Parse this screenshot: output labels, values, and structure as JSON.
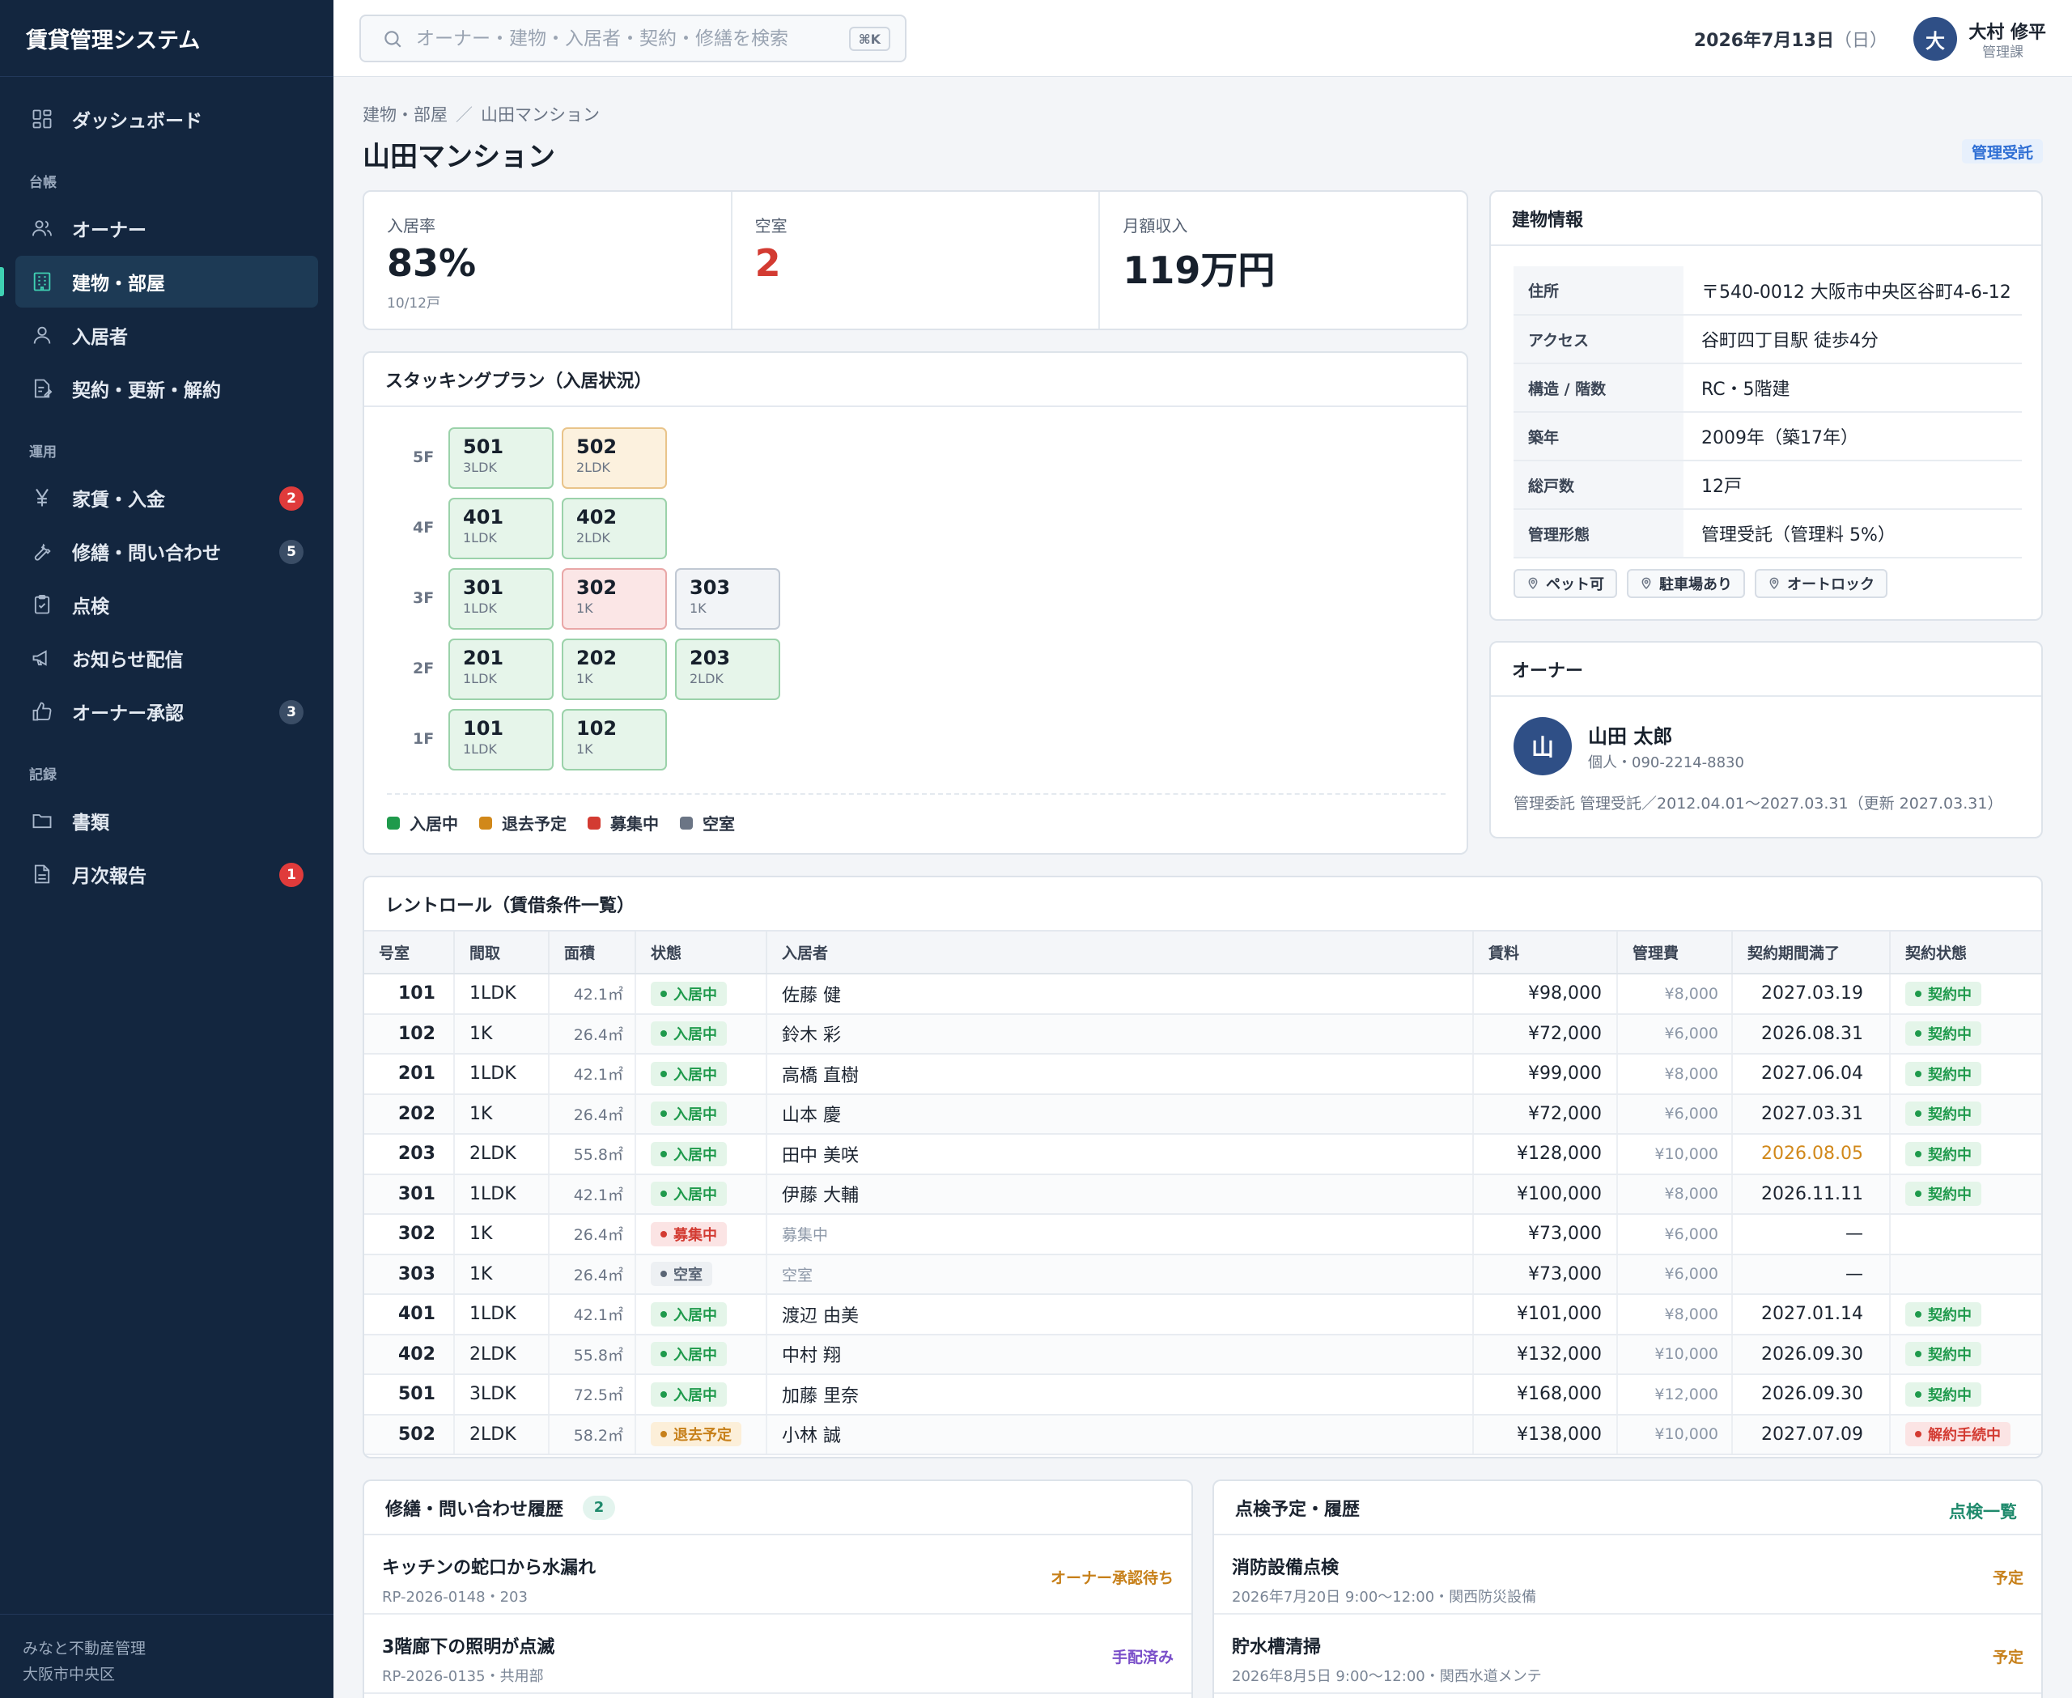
{
  "app_title": "賃貸管理システム",
  "sidebar": {
    "items": [
      {
        "label": "ダッシュボード",
        "icon": "dashboard-icon"
      },
      {
        "section": "台帳"
      },
      {
        "label": "オーナー",
        "icon": "owners-icon"
      },
      {
        "label": "建物・部屋",
        "icon": "building-icon",
        "active": true
      },
      {
        "label": "入居者",
        "icon": "tenant-icon"
      },
      {
        "label": "契約・更新・解約",
        "icon": "contract-icon"
      },
      {
        "section": "運用"
      },
      {
        "label": "家賃・入金",
        "icon": "yen-icon",
        "badge": "2"
      },
      {
        "label": "修繕・問い合わせ",
        "icon": "wrench-icon",
        "badge": "5"
      },
      {
        "label": "点検",
        "icon": "clipboard-icon"
      },
      {
        "label": "お知らせ配信",
        "icon": "megaphone-icon"
      },
      {
        "label": "オーナー承認",
        "icon": "thumbs-up-icon",
        "badge": "3"
      },
      {
        "section": "記録"
      },
      {
        "label": "書類",
        "icon": "folder-icon"
      },
      {
        "label": "月次報告",
        "icon": "report-icon",
        "badge": "1"
      }
    ],
    "labels": {
      "dashboard": "ダッシュボード",
      "sec_ledger": "台帳",
      "owners": "オーナー",
      "buildings": "建物・部屋",
      "tenants": "入居者",
      "contracts": "契約・更新・解約",
      "sec_ops": "運用",
      "rent": "家賃・入金",
      "repairs": "修繕・問い合わせ",
      "inspection": "点検",
      "notice": "お知らせ配信",
      "approval": "オーナー承認",
      "sec_records": "記録",
      "docs": "書類",
      "monthly": "月次報告"
    },
    "badges": {
      "rent": "2",
      "repairs": "5",
      "approval": "3",
      "monthly": "1"
    },
    "footer_company": "みなと不動産管理",
    "footer_area": "大阪市中央区"
  },
  "topbar": {
    "search_placeholder": "オーナー・建物・入居者・契約・修繕を検索",
    "search_shortcut": "⌘K",
    "date": "2026年7月13日",
    "weekday": "（日）",
    "user_initial": "大",
    "user_name": "大村 修平",
    "user_role": "管理課"
  },
  "page": {
    "breadcrumb_parent": "建物・部屋",
    "breadcrumb_sep": "／",
    "breadcrumb_current": "山田マンション",
    "title": "山田マンション",
    "management_tag": "管理受託"
  },
  "stats": {
    "occupancy_label": "入居率",
    "occupancy_value": "83%",
    "occupancy_sub": "10/12戸",
    "vacancy_label": "空室",
    "vacancy_value": "2",
    "income_label": "月額収入",
    "income_value": "119万円"
  },
  "stacking": {
    "title": "スタッキングプラン（入居状況）",
    "floors": [
      "5F",
      "4F",
      "3F",
      "2F",
      "1F"
    ],
    "units": [
      {
        "num": "501",
        "layout": "3LDK",
        "status": "occ"
      },
      {
        "num": "502",
        "layout": "2LDK",
        "status": "leave"
      },
      {
        "num": "401",
        "layout": "1LDK",
        "status": "occ"
      },
      {
        "num": "402",
        "layout": "2LDK",
        "status": "occ"
      },
      {
        "num": "301",
        "layout": "1LDK",
        "status": "occ"
      },
      {
        "num": "302",
        "layout": "1K",
        "status": "recruit"
      },
      {
        "num": "303",
        "layout": "1K",
        "status": "vacant"
      },
      {
        "num": "201",
        "layout": "1LDK",
        "status": "occ"
      },
      {
        "num": "202",
        "layout": "1K",
        "status": "occ"
      },
      {
        "num": "203",
        "layout": "2LDK",
        "status": "occ"
      },
      {
        "num": "101",
        "layout": "1LDK",
        "status": "occ"
      },
      {
        "num": "102",
        "layout": "1K",
        "status": "occ"
      }
    ],
    "legend": [
      {
        "label": "入居中",
        "color": "#1f9a4c"
      },
      {
        "label": "退去予定",
        "color": "#d1881a"
      },
      {
        "label": "募集中",
        "color": "#d33b32"
      },
      {
        "label": "空室",
        "color": "#6b7585"
      }
    ]
  },
  "building_info": {
    "title": "建物情報",
    "rows": [
      {
        "k": "住所",
        "v": "〒540-0012 大阪市中央区谷町4-6-12"
      },
      {
        "k": "アクセス",
        "v": "谷町四丁目駅 徒歩4分"
      },
      {
        "k": "構造 / 階数",
        "v": "RC・5階建"
      },
      {
        "k": "築年",
        "v": "2009年（築17年）"
      },
      {
        "k": "総戸数",
        "v": "12戸"
      },
      {
        "k": "管理形態",
        "v": "管理受託（管理料 5%）"
      }
    ],
    "chips": [
      "ペット可",
      "駐車場あり",
      "オートロック"
    ]
  },
  "owner": {
    "title": "オーナー",
    "initial": "山",
    "name": "山田 太郎",
    "sub": "個人・090-2214-8830",
    "contract": "管理委託 管理受託／2012.04.01〜2027.03.31（更新 2027.03.31）"
  },
  "rent_roll": {
    "title": "レントロール（賃借条件一覧）",
    "columns": [
      "号室",
      "間取",
      "面積",
      "状態",
      "入居者",
      "賃料",
      "管理費",
      "契約期間満了",
      "契約状態"
    ],
    "rows": [
      {
        "room": "101",
        "layout": "1LDK",
        "area": "42.1㎡",
        "status": "入居中",
        "sc": "green",
        "tenant": "佐藤 健",
        "rent": "¥98,000",
        "fee": "¥8,000",
        "end": "2027.03.19",
        "contract": "契約中",
        "cc": "green"
      },
      {
        "room": "102",
        "layout": "1K",
        "area": "26.4㎡",
        "status": "入居中",
        "sc": "green",
        "tenant": "鈴木 彩",
        "rent": "¥72,000",
        "fee": "¥6,000",
        "end": "2026.08.31",
        "contract": "契約中",
        "cc": "green"
      },
      {
        "room": "201",
        "layout": "1LDK",
        "area": "42.1㎡",
        "status": "入居中",
        "sc": "green",
        "tenant": "高橋 直樹",
        "rent": "¥99,000",
        "fee": "¥8,000",
        "end": "2027.06.04",
        "contract": "契約中",
        "cc": "green"
      },
      {
        "room": "202",
        "layout": "1K",
        "area": "26.4㎡",
        "status": "入居中",
        "sc": "green",
        "tenant": "山本 慶",
        "rent": "¥72,000",
        "fee": "¥6,000",
        "end": "2027.03.31",
        "contract": "契約中",
        "cc": "green"
      },
      {
        "room": "203",
        "layout": "2LDK",
        "area": "55.8㎡",
        "status": "入居中",
        "sc": "green",
        "tenant": "田中 美咲",
        "rent": "¥128,000",
        "fee": "¥10,000",
        "end": "2026.08.05",
        "end_warn": true,
        "contract": "契約中",
        "cc": "green"
      },
      {
        "room": "301",
        "layout": "1LDK",
        "area": "42.1㎡",
        "status": "入居中",
        "sc": "green",
        "tenant": "伊藤 大輔",
        "rent": "¥100,000",
        "fee": "¥8,000",
        "end": "2026.11.11",
        "contract": "契約中",
        "cc": "green"
      },
      {
        "room": "302",
        "layout": "1K",
        "area": "26.4㎡",
        "status": "募集中",
        "sc": "red",
        "tenant": "募集中",
        "tenant_muted": true,
        "rent": "¥73,000",
        "fee": "¥6,000",
        "end": "—",
        "contract": "",
        "cc": ""
      },
      {
        "room": "303",
        "layout": "1K",
        "area": "26.4㎡",
        "status": "空室",
        "sc": "gray",
        "tenant": "空室",
        "tenant_muted": true,
        "rent": "¥73,000",
        "fee": "¥6,000",
        "end": "—",
        "contract": "",
        "cc": ""
      },
      {
        "room": "401",
        "layout": "1LDK",
        "area": "42.1㎡",
        "status": "入居中",
        "sc": "green",
        "tenant": "渡辺 由美",
        "rent": "¥101,000",
        "fee": "¥8,000",
        "end": "2027.01.14",
        "contract": "契約中",
        "cc": "green"
      },
      {
        "room": "402",
        "layout": "2LDK",
        "area": "55.8㎡",
        "status": "入居中",
        "sc": "green",
        "tenant": "中村 翔",
        "rent": "¥132,000",
        "fee": "¥10,000",
        "end": "2026.09.30",
        "contract": "契約中",
        "cc": "green"
      },
      {
        "room": "501",
        "layout": "3LDK",
        "area": "72.5㎡",
        "status": "入居中",
        "sc": "green",
        "tenant": "加藤 里奈",
        "rent": "¥168,000",
        "fee": "¥12,000",
        "end": "2026.09.30",
        "contract": "契約中",
        "cc": "green"
      },
      {
        "room": "502",
        "layout": "2LDK",
        "area": "58.2㎡",
        "status": "退去予定",
        "sc": "amber",
        "tenant": "小林 誠",
        "rent": "¥138,000",
        "fee": "¥10,000",
        "end": "2027.07.09",
        "contract": "解約手続中",
        "cc": "red"
      }
    ]
  },
  "repairs": {
    "title": "修繕・問い合わせ履歴",
    "count": "2",
    "items": [
      {
        "title": "キッチンの蛇口から水漏れ",
        "sub": "RP-2026-0148・203",
        "status": "オーナー承認待ち",
        "tone": "amber"
      },
      {
        "title": "3階廊下の照明が点滅",
        "sub": "RP-2026-0135・共用部",
        "status": "手配済み",
        "tone": "purple"
      }
    ]
  },
  "inspections": {
    "title": "点検予定・履歴",
    "link": "点検一覧",
    "items": [
      {
        "title": "消防設備点検",
        "sub": "2026年7月20日 9:00〜12:00・関西防災設備",
        "status": "予定",
        "tone": "amber"
      },
      {
        "title": "貯水槽清掃",
        "sub": "2026年8月5日 9:00〜12:00・関西水道メンテ",
        "status": "予定",
        "tone": "amber"
      }
    ]
  }
}
